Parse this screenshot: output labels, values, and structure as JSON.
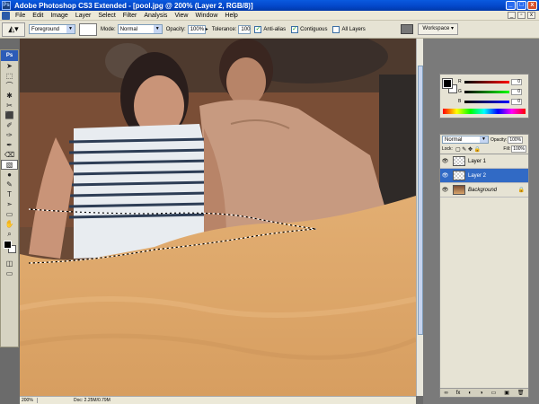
{
  "window": {
    "title": "Adobe Photoshop CS3 Extended - [pool.jpg @ 200% (Layer 2, RGB/8)]",
    "app_logo": "Ps"
  },
  "menus": [
    "File",
    "Edit",
    "Image",
    "Layer",
    "Select",
    "Filter",
    "Analysis",
    "View",
    "Window",
    "Help"
  ],
  "options": {
    "fill_source": "Foreground",
    "mode_label": "Mode:",
    "mode_value": "Normal",
    "opacity_label": "Opacity:",
    "opacity_value": "100%",
    "tolerance_label": "Tolerance:",
    "tolerance_value": "100",
    "anti_alias_label": "Anti-alias",
    "contiguous_label": "Contiguous",
    "all_layers_label": "All Layers",
    "workspace_label": "Workspace ▾"
  },
  "toolbox": {
    "header": "Ps",
    "tools": [
      "➤",
      "⬚",
      "⌒",
      "✱",
      "✂",
      "⬛",
      "✐",
      "✑",
      "✒",
      "⌫",
      "▧",
      "●",
      "✎",
      "T",
      "➣",
      "▭",
      "✋",
      "⌕"
    ]
  },
  "status": {
    "zoom": "200%",
    "doc": "Doc: 2.25M/0.79M"
  },
  "color_panel": {
    "r_label": "R",
    "r_value": "0",
    "g_label": "G",
    "g_value": "0",
    "b_label": "B",
    "b_value": "0"
  },
  "layers_panel": {
    "blend_mode": "Normal",
    "opacity_label": "Opacity:",
    "opacity_value": "100%",
    "lock_label": "Lock:",
    "fill_label": "Fill:",
    "fill_value": "100%",
    "layers": [
      {
        "name": "Layer 1",
        "selected": false
      },
      {
        "name": "Layer 2",
        "selected": true
      },
      {
        "name": "Background",
        "selected": false,
        "locked": true
      }
    ],
    "footer_icons": [
      "∞",
      "fx",
      "◐",
      "◑",
      "▭",
      "▣",
      "🗑"
    ]
  },
  "colors": {
    "titlebar": "#0346c8",
    "selection_layer": "#316ac5",
    "water": "#d9a56b"
  }
}
